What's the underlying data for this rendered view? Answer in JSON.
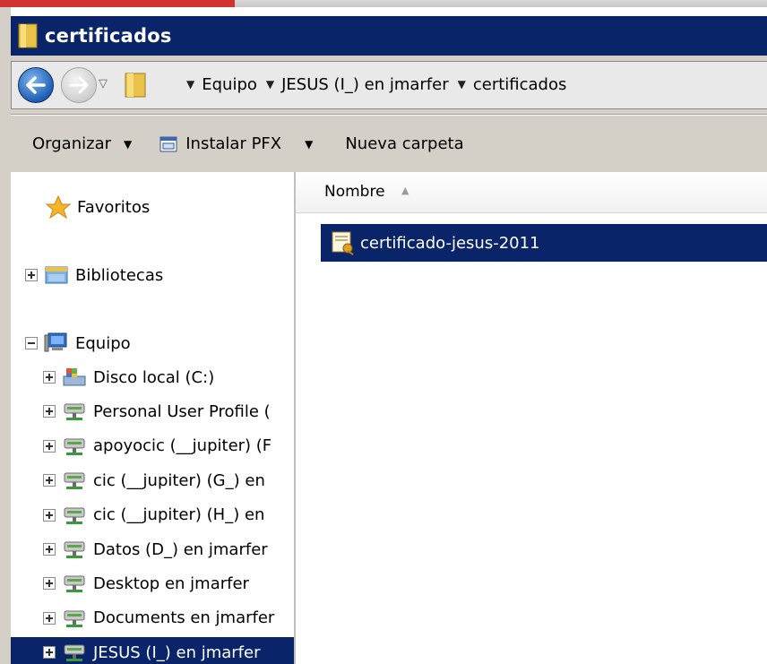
{
  "window": {
    "title": "certificados"
  },
  "address": {
    "crumbs": [
      {
        "label": "Equipo"
      },
      {
        "label": "JESUS (I_) en jmarfer"
      },
      {
        "label": "certificados"
      }
    ]
  },
  "toolbar": {
    "organize": "Organizar",
    "install_pfx": "Instalar PFX",
    "new_folder": "Nueva carpeta"
  },
  "nav": {
    "favorites": "Favoritos",
    "libraries": "Bibliotecas",
    "computer": "Equipo",
    "drives": [
      {
        "label": "Disco local (C:)",
        "icon": "local-disk-icon"
      },
      {
        "label": "Personal User Profile (",
        "icon": "network-drive-icon"
      },
      {
        "label": "apoyocic (__jupiter) (F",
        "icon": "network-drive-icon"
      },
      {
        "label": "cic (__jupiter) (G_) en",
        "icon": "network-drive-icon"
      },
      {
        "label": "cic (__jupiter) (H_) en",
        "icon": "network-drive-icon"
      },
      {
        "label": "Datos (D_) en jmarfer",
        "icon": "network-drive-icon"
      },
      {
        "label": "Desktop en jmarfer",
        "icon": "network-drive-icon"
      },
      {
        "label": "Documents en jmarfer",
        "icon": "network-drive-icon"
      },
      {
        "label": "JESUS (I_) en jmarfer",
        "icon": "network-drive-icon"
      }
    ]
  },
  "content": {
    "column_name": "Nombre",
    "files": [
      {
        "name": "certificado-jesus-2011",
        "icon": "certificate-icon"
      }
    ]
  },
  "colors": {
    "selection": "#0a246a",
    "titlebar": "#0a246a",
    "chrome": "#d4d0c8"
  }
}
